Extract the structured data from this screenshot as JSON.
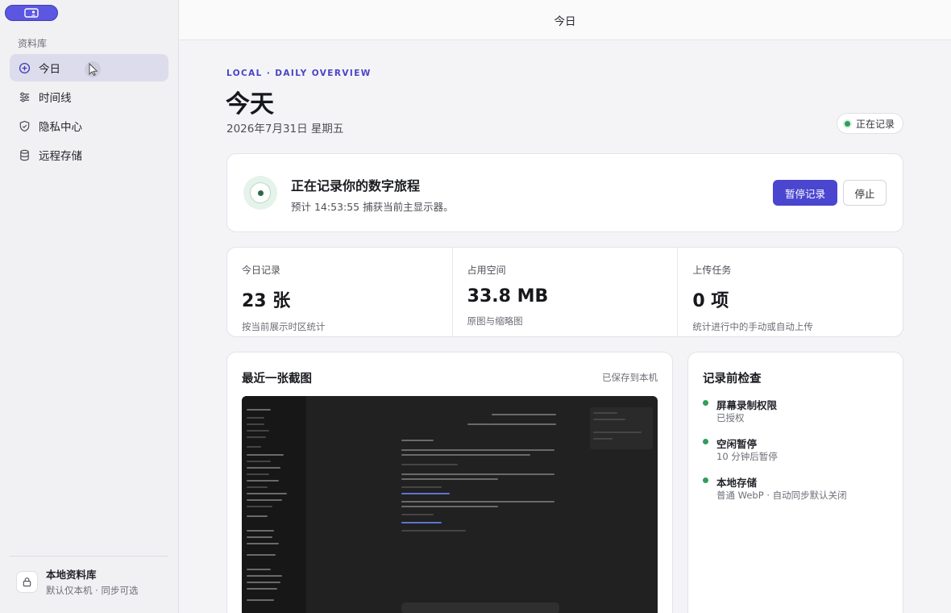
{
  "sidebar": {
    "section_label": "资料库",
    "items": [
      {
        "label": "今日",
        "icon": "plus-circle-icon",
        "active": true
      },
      {
        "label": "时间线",
        "icon": "sliders-icon",
        "active": false
      },
      {
        "label": "隐私中心",
        "icon": "shield-icon",
        "active": false
      },
      {
        "label": "远程存储",
        "icon": "database-icon",
        "active": false
      }
    ],
    "library": {
      "title": "本地资料库",
      "subtitle": "默认仅本机 · 同步可选",
      "icon": "lock-icon"
    }
  },
  "header": {
    "title": "今日"
  },
  "overview": {
    "eyebrow": "LOCAL · DAILY OVERVIEW",
    "title": "今天",
    "date": "2026年7月31日 星期五",
    "status_badge": "正在记录"
  },
  "recording": {
    "title": "正在记录你的数字旅程",
    "subtitle": "预计 14:53:55 捕获当前主显示器。",
    "pause_label": "暂停记录",
    "stop_label": "停止"
  },
  "stats": [
    {
      "label": "今日记录",
      "value": "23 张",
      "sub": "按当前展示时区统计"
    },
    {
      "label": "占用空间",
      "value": "33.8 MB",
      "sub": "原图与缩略图"
    },
    {
      "label": "上传任务",
      "value": "0 项",
      "sub": "统计进行中的手动或自动上传"
    }
  ],
  "screenshot": {
    "title": "最近一张截图",
    "saved": "已保存到本机"
  },
  "checks": {
    "title": "记录前检查",
    "items": [
      {
        "title": "屏幕录制权限",
        "sub": "已授权"
      },
      {
        "title": "空闲暂停",
        "sub": "10 分钟后暂停"
      },
      {
        "title": "本地存储",
        "sub": "普通 WebP · 自动同步默认关闭"
      }
    ]
  },
  "colors": {
    "accent": "#4a46cf",
    "status_green": "#2f9e5b"
  }
}
